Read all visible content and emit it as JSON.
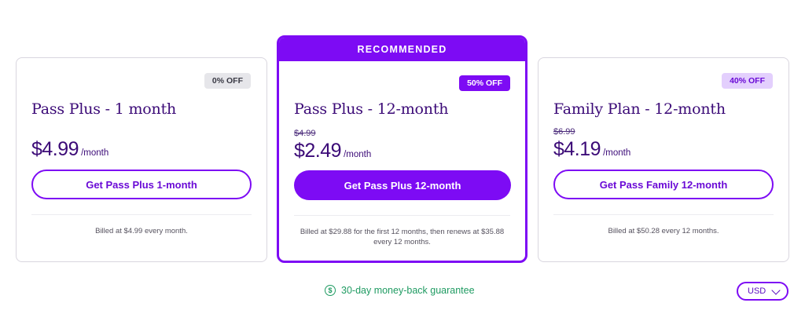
{
  "colors": {
    "accent": "#7d0bf4",
    "title": "#3b0a77",
    "guarantee": "#1f9b62"
  },
  "plans": [
    {
      "badge": "0% OFF",
      "title": "Pass Plus - 1 month",
      "price": "$4.99",
      "per": "/month",
      "cta": "Get Pass Plus 1-month",
      "billing": "Billed at $4.99 every month."
    },
    {
      "banner": "RECOMMENDED",
      "badge": "50% OFF",
      "title": "Pass Plus - 12-month",
      "old_price": "$4.99",
      "price": "$2.49",
      "per": "/month",
      "cta": "Get Pass Plus 12-month",
      "billing": "Billed at $29.88 for the first 12 months, then renews at $35.88 every 12 months."
    },
    {
      "badge": "40% OFF",
      "title": "Family Plan - 12-month",
      "old_price": "$6.99",
      "price": "$4.19",
      "per": "/month",
      "cta": "Get Pass Family 12-month",
      "billing": "Billed at $50.28 every 12 months."
    }
  ],
  "guarantee": {
    "icon": "dollar-circle-icon",
    "symbol": "$",
    "text": "30-day money-back guarantee"
  },
  "currency": {
    "selected": "USD",
    "icon": "chevron-down-icon"
  }
}
